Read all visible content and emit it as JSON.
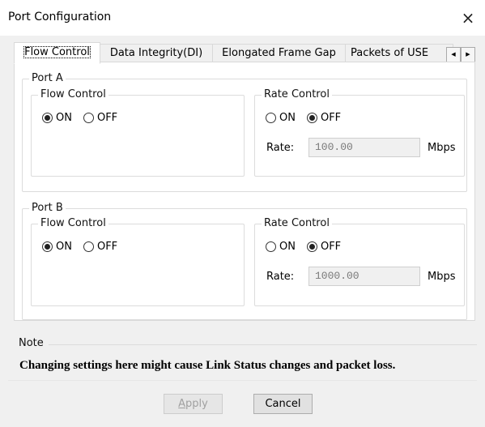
{
  "window": {
    "title": "Port Configuration",
    "close_glyph": "×"
  },
  "tabs": [
    {
      "label": "Flow Control",
      "active": true
    },
    {
      "label": "Data Integrity(DI)",
      "active": false
    },
    {
      "label": "Elongated Frame Gap",
      "active": false
    },
    {
      "label": "Packets of USE",
      "active": false
    }
  ],
  "tab_scroll": {
    "left": "◀",
    "right": "▶"
  },
  "ports": [
    {
      "title": "Port A",
      "flow_control": {
        "title": "Flow Control",
        "on_label": "ON",
        "off_label": "OFF",
        "selected": "ON"
      },
      "rate_control": {
        "title": "Rate Control",
        "on_label": "ON",
        "off_label": "OFF",
        "selected": "OFF",
        "rate_label": "Rate:",
        "rate_value": "100.00",
        "unit": "Mbps"
      }
    },
    {
      "title": "Port B",
      "flow_control": {
        "title": "Flow Control",
        "on_label": "ON",
        "off_label": "OFF",
        "selected": "ON"
      },
      "rate_control": {
        "title": "Rate Control",
        "on_label": "ON",
        "off_label": "OFF",
        "selected": "OFF",
        "rate_label": "Rate:",
        "rate_value": "1000.00",
        "unit": "Mbps"
      }
    }
  ],
  "note": {
    "title": "Note",
    "text": "Changing settings here might cause Link Status changes and packet loss."
  },
  "buttons": {
    "apply_first": "A",
    "apply_rest": "pply",
    "cancel": "Cancel"
  }
}
